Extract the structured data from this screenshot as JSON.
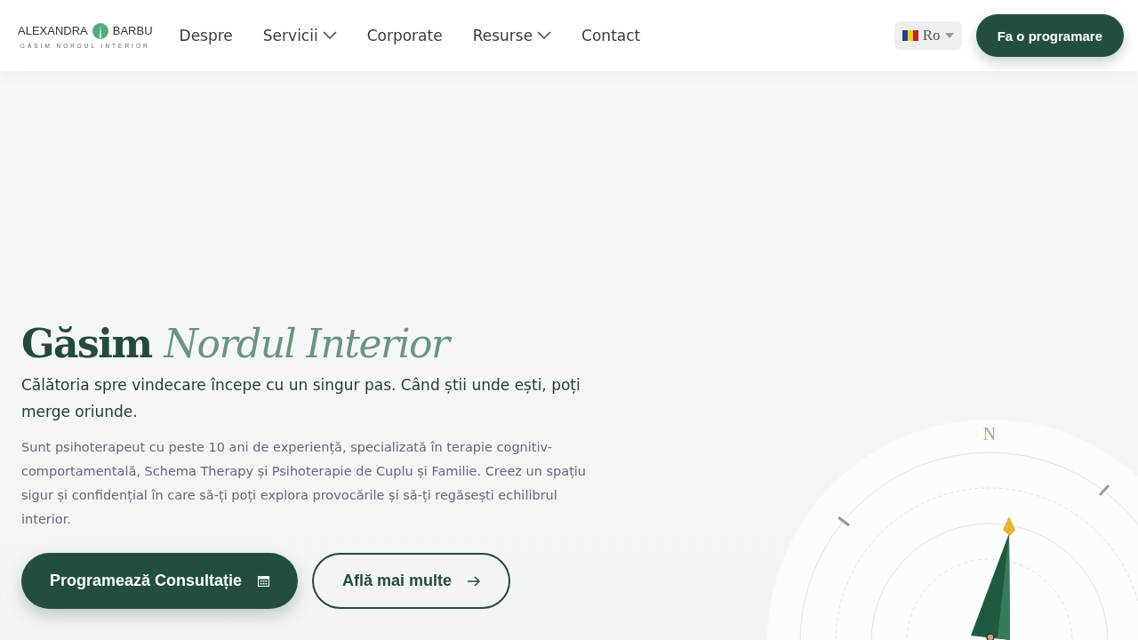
{
  "logo": {
    "first": "ALEXANDRA",
    "last": "BARBU",
    "tagline": "GASIM NORDUL INTERIOR"
  },
  "nav": [
    {
      "label": "Despre",
      "dropdown": false
    },
    {
      "label": "Servicii",
      "dropdown": true
    },
    {
      "label": "Corporate",
      "dropdown": false
    },
    {
      "label": "Resurse",
      "dropdown": true
    },
    {
      "label": "Contact",
      "dropdown": false
    }
  ],
  "language": {
    "label": "Ro"
  },
  "cta": "Fa o programare",
  "hero": {
    "title": "Găsim",
    "title_accent": "Nordul Interior",
    "subtitle": "Călătoria spre vindecare începe cu un singur pas. Când știi unde ești, poți merge oriunde.",
    "body": "Sunt psihoterapeut cu peste 10 ani de experiență, specializată în terapie cognitiv-comportamentală, Schema Therapy și Psihoterapie de Cuplu și Familie. Creez un spațiu sigur și confidențial în care să-ți poți explora provocările și să-ți regăsești echilibrul interior.",
    "primary_button": "Programează Consultație",
    "secondary_button": "Află mai multe"
  },
  "compass": {
    "north_label": "N"
  }
}
